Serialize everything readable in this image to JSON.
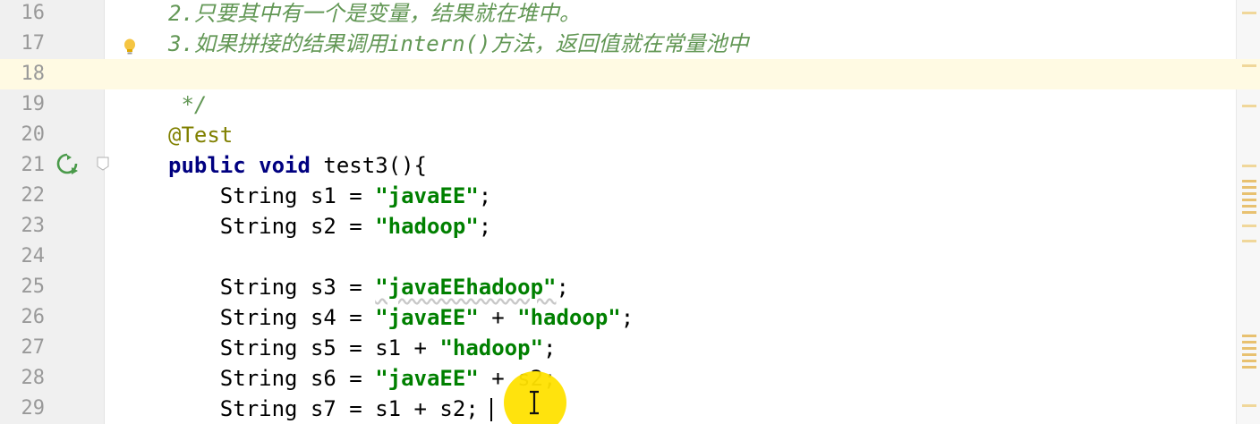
{
  "editor": {
    "lines": [
      {
        "number": "16",
        "segments": [
          {
            "type": "comment",
            "text": "2.只要其中有一个是变量，结果就在堆中。"
          }
        ]
      },
      {
        "number": "17",
        "segments": [
          {
            "type": "comment",
            "text": "3.如果拼接的结果调用intern()方法，返回值就在常量池中"
          }
        ]
      },
      {
        "number": "18",
        "segments": []
      },
      {
        "number": "19",
        "segments": [
          {
            "type": "comment",
            "text": " */"
          }
        ]
      },
      {
        "number": "20",
        "segments": [
          {
            "type": "annotation",
            "text": "@Test"
          }
        ]
      },
      {
        "number": "21",
        "segments": [
          {
            "type": "keyword",
            "text": "public void "
          },
          {
            "type": "plain",
            "text": "test3(){"
          }
        ]
      },
      {
        "number": "22",
        "segments": [
          {
            "type": "plain",
            "text": "    String s1 = "
          },
          {
            "type": "string",
            "text": "\"javaEE\""
          },
          {
            "type": "plain",
            "text": ";"
          }
        ]
      },
      {
        "number": "23",
        "segments": [
          {
            "type": "plain",
            "text": "    String s2 = "
          },
          {
            "type": "string",
            "text": "\"hadoop\""
          },
          {
            "type": "plain",
            "text": ";"
          }
        ]
      },
      {
        "number": "24",
        "segments": []
      },
      {
        "number": "25",
        "segments": [
          {
            "type": "plain",
            "text": "    String s3 = "
          },
          {
            "type": "string",
            "text": "\"javaEEhadoop\""
          },
          {
            "type": "plain",
            "text": ";"
          }
        ]
      },
      {
        "number": "26",
        "segments": [
          {
            "type": "plain",
            "text": "    String s4 = "
          },
          {
            "type": "string",
            "text": "\"javaEE\""
          },
          {
            "type": "plain",
            "text": " + "
          },
          {
            "type": "string",
            "text": "\"hadoop\""
          },
          {
            "type": "plain",
            "text": ";"
          }
        ]
      },
      {
        "number": "27",
        "segments": [
          {
            "type": "plain",
            "text": "    String s5 = s1 + "
          },
          {
            "type": "string",
            "text": "\"hadoop\""
          },
          {
            "type": "plain",
            "text": ";"
          }
        ]
      },
      {
        "number": "28",
        "segments": [
          {
            "type": "plain",
            "text": "    String s6 = "
          },
          {
            "type": "string",
            "text": "\"javaEE\""
          },
          {
            "type": "plain",
            "text": " + s2;"
          }
        ]
      },
      {
        "number": "29",
        "segments": [
          {
            "type": "plain",
            "text": "    String s7 = s1 + s2;"
          }
        ]
      }
    ],
    "current_line": "18"
  },
  "colors": {
    "comment": "#629755",
    "annotation": "#808000",
    "keyword": "#000080",
    "string": "#008000",
    "current_line_bg": "#fffae3",
    "gutter_bg": "#f0f0f0",
    "line_number": "#999999",
    "marker": "#e8c170",
    "cursor_highlight": "#ffe100"
  },
  "icons": {
    "intention": "lightbulb-icon",
    "run": "run-test-icon",
    "fold": "fold-icon",
    "pointer": "text-cursor-icon"
  }
}
